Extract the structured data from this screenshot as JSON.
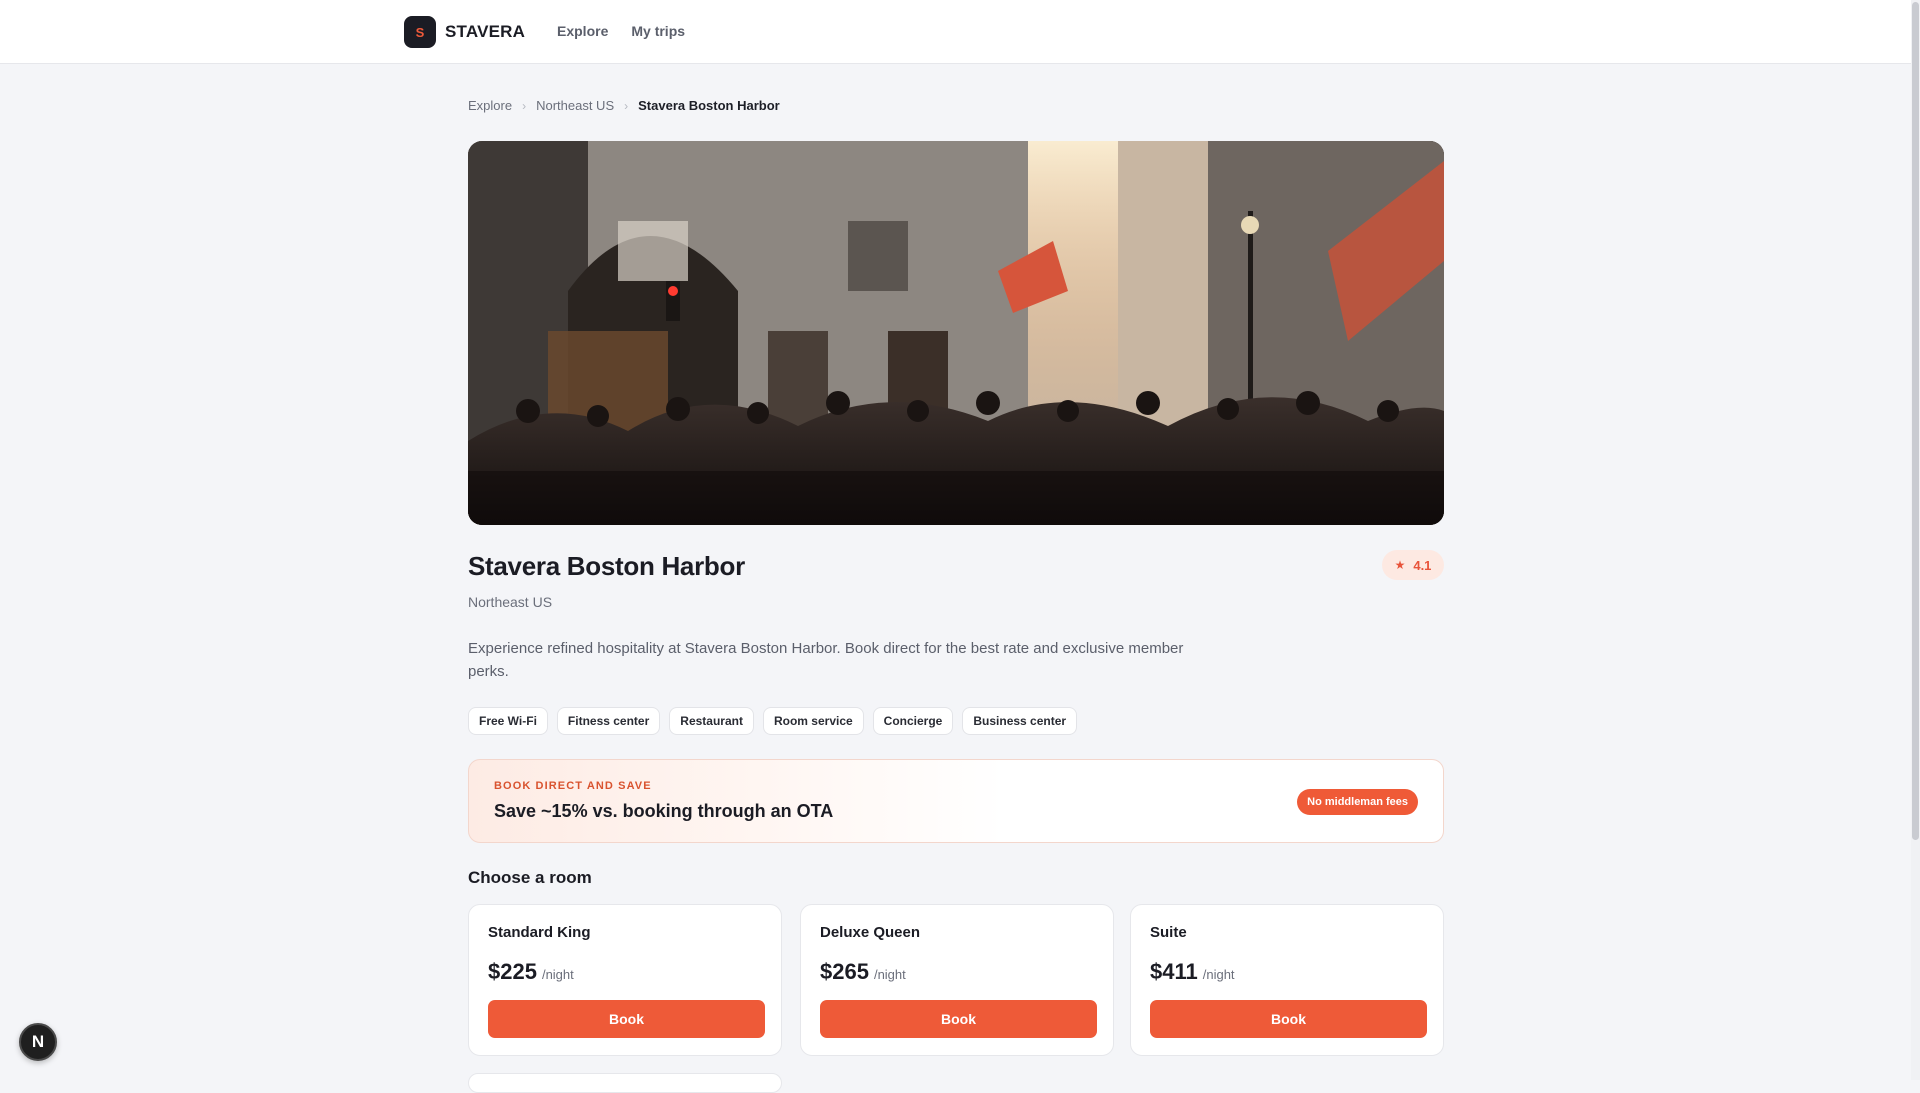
{
  "brand": {
    "logo_letter": "S",
    "name": "STAVERA"
  },
  "nav": [
    {
      "label": "Explore"
    },
    {
      "label": "My trips"
    }
  ],
  "breadcrumb": [
    {
      "label": "Explore"
    },
    {
      "label": "Northeast US"
    },
    {
      "label": "Stavera Boston Harbor"
    }
  ],
  "hotel": {
    "name": "Stavera Boston Harbor",
    "region": "Northeast US",
    "rating": "4.1",
    "description": "Experience refined hospitality at Stavera Boston Harbor. Book direct for the best rate and exclusive member perks.",
    "amenities": [
      "Free Wi-Fi",
      "Fitness center",
      "Restaurant",
      "Room service",
      "Concierge",
      "Business center"
    ]
  },
  "promo": {
    "kicker": "BOOK DIRECT AND SAVE",
    "title": "Save ~15% vs. booking through an OTA",
    "badge": "No middleman fees"
  },
  "rooms_section": {
    "title": "Choose a room",
    "rooms": [
      {
        "name": "Standard King",
        "price": "$225",
        "unit": "/night",
        "button": "Book"
      },
      {
        "name": "Deluxe Queen",
        "price": "$265",
        "unit": "/night",
        "button": "Book"
      },
      {
        "name": "Suite",
        "price": "$411",
        "unit": "/night",
        "button": "Book"
      }
    ]
  },
  "dev_indicator": {
    "letter": "N"
  },
  "colors": {
    "accent": "#ee5a38",
    "background": "#f4f5f8",
    "text_dark": "#1b1c24",
    "text_muted": "#6b6f7b"
  },
  "icons": {
    "rating": "star-icon",
    "breadcrumb_separator": "chevron-right-icon"
  }
}
